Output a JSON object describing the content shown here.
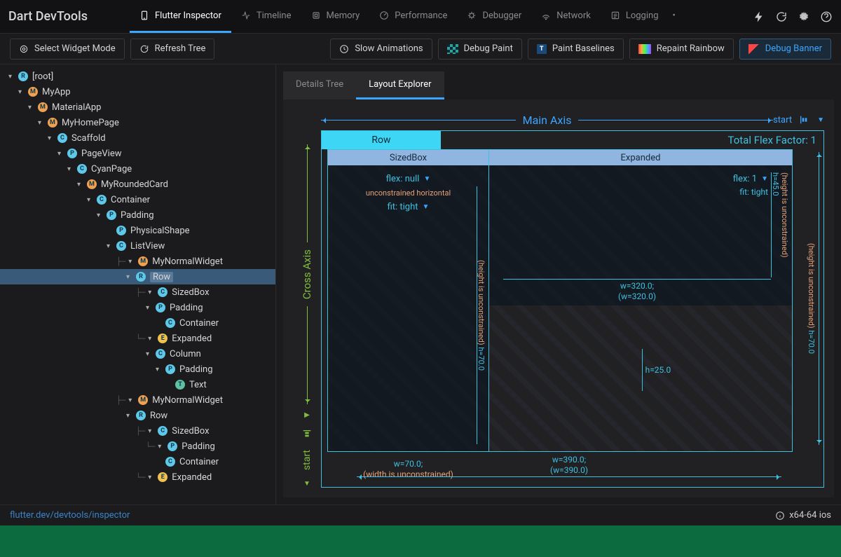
{
  "app": {
    "title": "Dart DevTools"
  },
  "tabs": [
    {
      "label": "Flutter Inspector",
      "icon": "phone-icon",
      "active": true
    },
    {
      "label": "Timeline",
      "icon": "timeline-icon"
    },
    {
      "label": "Memory",
      "icon": "memory-icon"
    },
    {
      "label": "Performance",
      "icon": "performance-icon"
    },
    {
      "label": "Debugger",
      "icon": "bug-icon"
    },
    {
      "label": "Network",
      "icon": "network-icon"
    },
    {
      "label": "Logging",
      "icon": "logging-icon"
    }
  ],
  "top_icons": [
    "more-icon",
    "bolt-icon",
    "reload-icon",
    "gear-icon",
    "help-icon"
  ],
  "toolbar": {
    "select_widget": "Select Widget Mode",
    "refresh_tree": "Refresh Tree",
    "slow_anim": "Slow Animations",
    "debug_paint": "Debug Paint",
    "paint_baselines": "Paint Baselines",
    "repaint_rainbow": "Repaint Rainbow",
    "debug_banner": "Debug Banner"
  },
  "tree": [
    {
      "d": 0,
      "b": "R",
      "l": "[root]",
      "c": true
    },
    {
      "d": 1,
      "b": "M",
      "l": "MyApp",
      "c": true
    },
    {
      "d": 2,
      "b": "M",
      "l": "MaterialApp",
      "c": true
    },
    {
      "d": 3,
      "b": "M",
      "l": "MyHomePage",
      "c": true
    },
    {
      "d": 4,
      "b": "C",
      "l": "Scaffold",
      "c": true
    },
    {
      "d": 5,
      "b": "P",
      "l": "PageView",
      "c": true
    },
    {
      "d": 6,
      "b": "C",
      "l": "CyanPage",
      "c": true
    },
    {
      "d": 7,
      "b": "M",
      "l": "MyRoundedCard",
      "c": true
    },
    {
      "d": 8,
      "b": "C",
      "l": "Container",
      "c": true
    },
    {
      "d": 9,
      "b": "P",
      "l": "Padding",
      "c": true
    },
    {
      "d": 10,
      "b": "P",
      "l": "PhysicalShape",
      "c": false,
      "nochev": true
    },
    {
      "d": 10,
      "b": "C",
      "l": "ListView",
      "c": true
    },
    {
      "d": 11,
      "b": "M",
      "l": "MyNormalWidget",
      "c": true,
      "guide": "├"
    },
    {
      "d": 12,
      "b": "R",
      "l": "Row",
      "c": true,
      "selected": true
    },
    {
      "d": 13,
      "b": "C",
      "l": "SizedBox",
      "c": true,
      "guide": "├"
    },
    {
      "d": 14,
      "b": "P",
      "l": "Padding",
      "c": true
    },
    {
      "d": 15,
      "b": "C",
      "l": "Container",
      "nochev": true
    },
    {
      "d": 13,
      "b": "E",
      "l": "Expanded",
      "c": true,
      "guide": "└"
    },
    {
      "d": 14,
      "b": "C",
      "l": "Column",
      "c": true
    },
    {
      "d": 15,
      "b": "P",
      "l": "Padding",
      "c": true
    },
    {
      "d": 16,
      "b": "T",
      "l": "Text",
      "nochev": true
    },
    {
      "d": 11,
      "b": "M",
      "l": "MyNormalWidget",
      "c": true,
      "guide": "├"
    },
    {
      "d": 12,
      "b": "R",
      "l": "Row",
      "c": true
    },
    {
      "d": 13,
      "b": "C",
      "l": "SizedBox",
      "c": true,
      "guide": "├"
    },
    {
      "d": 14,
      "b": "P",
      "l": "Padding",
      "c": true,
      "guide": "└"
    },
    {
      "d": 15,
      "b": "C",
      "l": "Container",
      "nochev": true
    },
    {
      "d": 13,
      "b": "E",
      "l": "Expanded",
      "c": true,
      "guide": "└"
    }
  ],
  "panel_tabs": {
    "details": "Details Tree",
    "layout": "Layout Explorer"
  },
  "layout": {
    "main_axis": "Main Axis",
    "main_align": "start",
    "cross_axis": "Cross Axis",
    "cross_align": "start",
    "row_label": "Row",
    "flex_factor": "Total Flex Factor: 1",
    "child1": {
      "title": "SizedBox",
      "flex": "flex: null",
      "constraint": "unconstrained horizontal",
      "fit": "fit: tight",
      "h": "h=70.0",
      "h_constr": "(height is unconstrained)",
      "w": "w=70.0;",
      "w_constr": "(width is unconstrained)"
    },
    "child2": {
      "title": "Expanded",
      "flex": "flex: 1",
      "fit": "fit: tight",
      "h": "h=45.0",
      "h_constr": "(height is unconstrained)",
      "w": "w=320.0;",
      "w_constr": "(w=320.0)",
      "h2": "h=25.0"
    },
    "outer": {
      "h": "h=70.0",
      "h_constr": "(height is unconstrained)",
      "w": "w=390.0;",
      "w_constr": "(w=390.0)"
    }
  },
  "status": {
    "link": "flutter.dev/devtools/inspector",
    "device": "x64-64 ios"
  }
}
